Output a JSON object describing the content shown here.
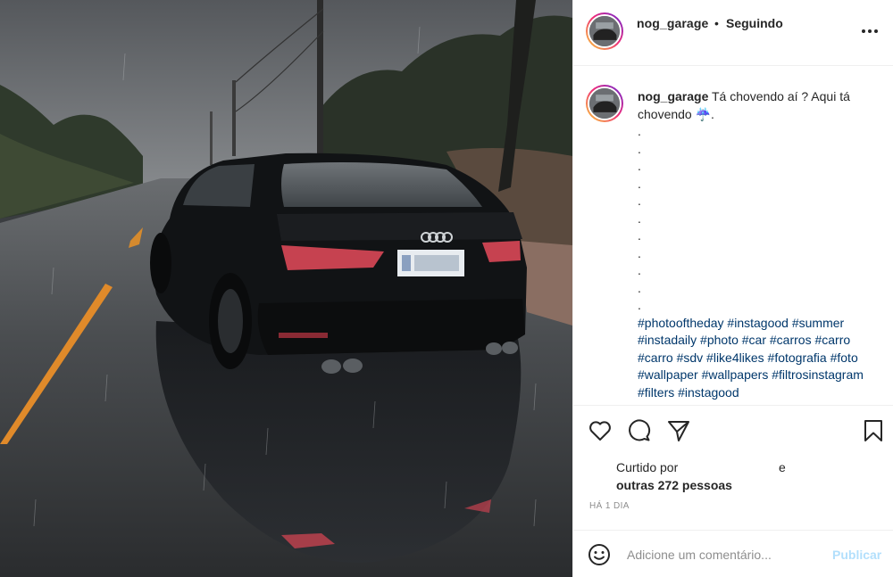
{
  "post": {
    "image_alt": "Audi preto em estrada molhada",
    "author": {
      "username": "nog_garage"
    },
    "separator": "•",
    "follow_status": "Seguindo",
    "caption": {
      "username": "nog_garage",
      "text": "Tá chovendo aí ? Aqui tá chovendo",
      "emoji": "☔",
      "end": ".",
      "dots": [
        ".",
        ".",
        ".",
        ".",
        ".",
        ".",
        ".",
        ".",
        ".",
        ".",
        "."
      ],
      "hashtags": [
        "#photooftheday",
        "#instagood",
        "#summer",
        "#instadaily",
        "#photo",
        "#car",
        "#carros",
        "#carro",
        "#carro",
        "#sdv",
        "#like4likes",
        "#fotografia",
        "#foto",
        "#wallpaper",
        "#wallpapers",
        "#filtrosinstagram",
        "#filters",
        "#instagood"
      ]
    },
    "likes": {
      "line1_prefix": "Curtido por",
      "line1_suffix": "e",
      "line2": "outras 272 pessoas"
    },
    "timestamp": "HÁ 1 DIA",
    "comment_box": {
      "placeholder": "Adicione um comentário...",
      "publish_label": "Publicar"
    }
  },
  "icons": {
    "more": "more-options-icon",
    "like": "heart-icon",
    "comment": "comment-icon",
    "share": "paper-plane-icon",
    "save": "bookmark-icon",
    "emoji": "emoji-face-icon"
  },
  "colors": {
    "hashtag": "#00376b",
    "publish_disabled": "#b2dffc",
    "muted": "#8e8e8e",
    "text": "#262626"
  }
}
